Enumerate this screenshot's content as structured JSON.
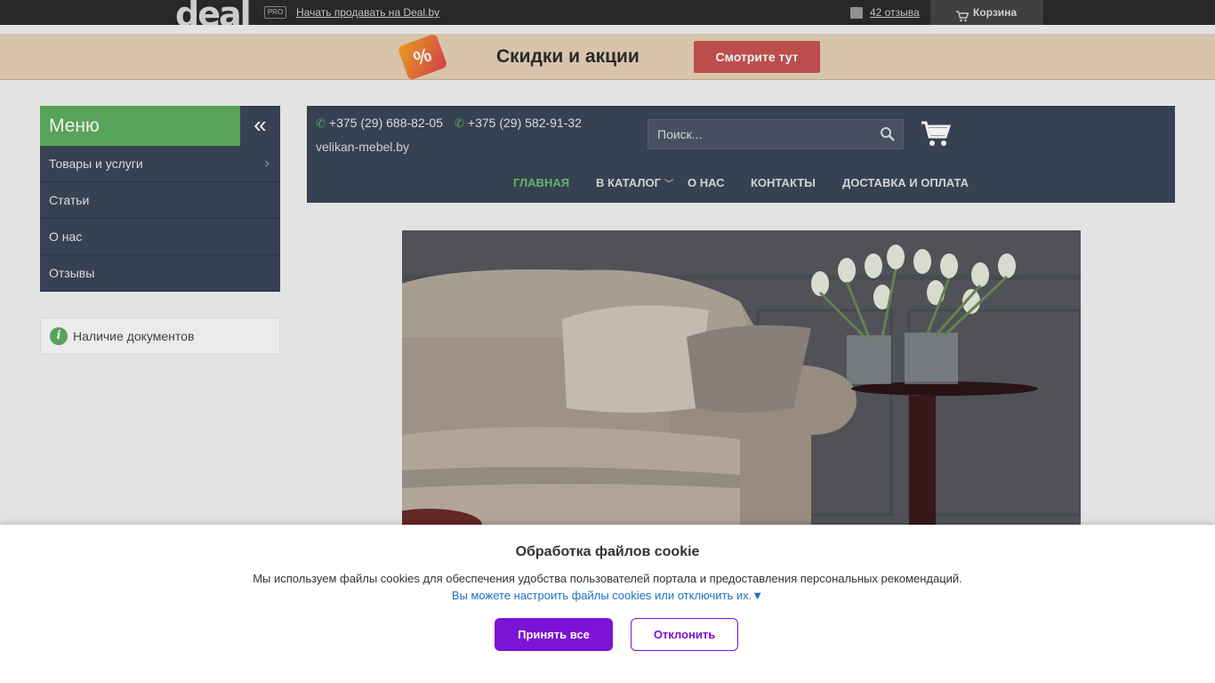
{
  "topbar": {
    "logo": "deal",
    "pro_badge": "PRO",
    "sell_link": "Начать продавать на Deal.by",
    "reviews_link": "42 отзыва",
    "cart_label": "Корзина"
  },
  "promo": {
    "tag_symbol": "%",
    "title": "Скидки и акции",
    "button": "Смотрите тут"
  },
  "sidebar": {
    "menu_title": "Меню",
    "collapse_symbol": "«",
    "items": [
      {
        "label": "Товары и услуги",
        "has_submenu": true
      },
      {
        "label": "Статьи",
        "has_submenu": false
      },
      {
        "label": "О нас",
        "has_submenu": false
      },
      {
        "label": "Отзывы",
        "has_submenu": false
      }
    ],
    "docs_label": "Наличие документов"
  },
  "header": {
    "phones": [
      "+375 (29) 688-82-05",
      "+375 (29) 582-91-32"
    ],
    "site": "velikan-mebel.by",
    "search_placeholder": "Поиск...",
    "nav": [
      {
        "label": "ГЛАВНАЯ",
        "active": true
      },
      {
        "label": "В КАТАЛОГ",
        "active": false,
        "dropdown": true
      },
      {
        "label": "О НАС",
        "active": false
      },
      {
        "label": "КОНТАКТЫ",
        "active": false
      },
      {
        "label": "ДОСТАВКА И ОПЛАТА",
        "active": false
      }
    ]
  },
  "cookie": {
    "title": "Обработка файлов cookie",
    "text": "Мы используем файлы cookies для обеспечения удобства пользователей портала и предоставления персональных рекомендаций.",
    "link": "Вы можете настроить файлы cookies или отключить их.▼",
    "accept": "Принять все",
    "decline": "Отклонить"
  },
  "colors": {
    "accent_green": "#5cae5f",
    "panel_dark": "#3a4658",
    "promo_red": "#c95252",
    "cookie_purple": "#7b12d6"
  }
}
